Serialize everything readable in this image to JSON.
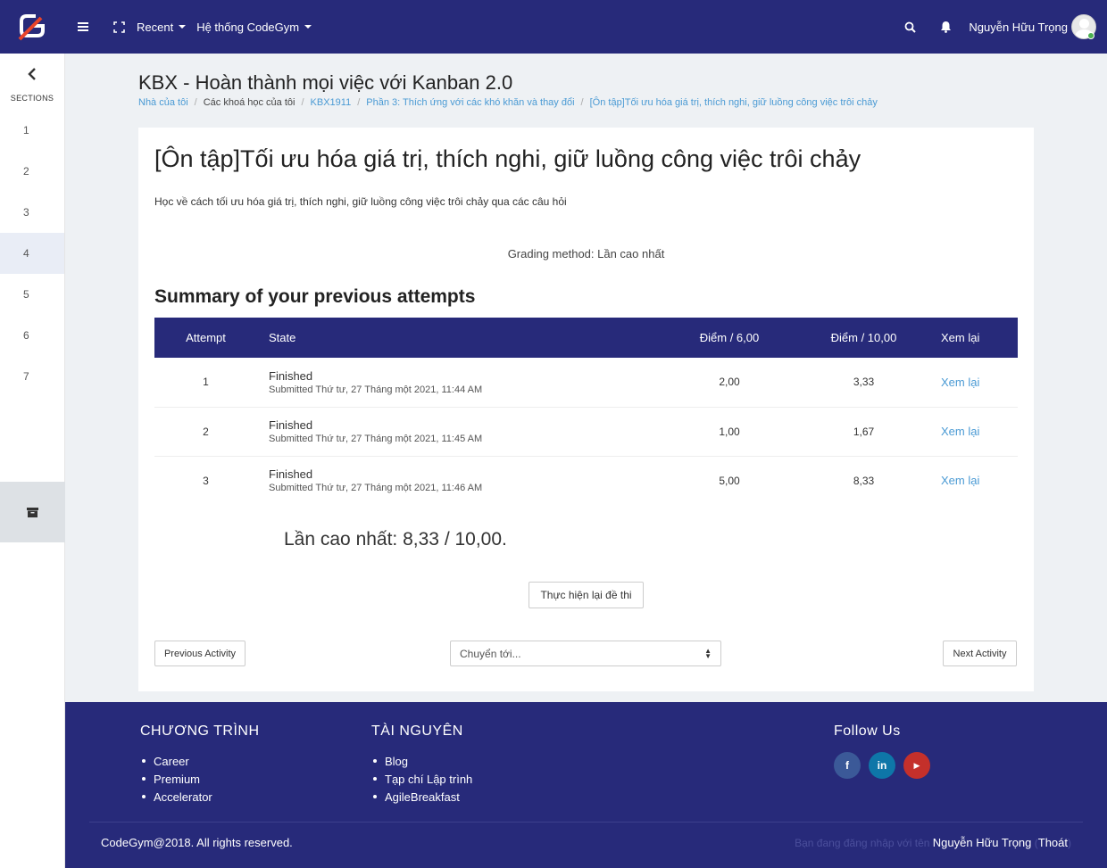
{
  "navbar": {
    "recent_label": "Recent",
    "system_label": "Hệ thống CodeGym",
    "username": "Nguyễn Hữu Trọng"
  },
  "sidebar": {
    "title": "SECTIONS",
    "items": [
      "1",
      "2",
      "3",
      "4",
      "5",
      "6",
      "7"
    ],
    "active_index": 3
  },
  "page": {
    "title": "KBX - Hoàn thành mọi việc với Kanban 2.0",
    "breadcrumb": [
      "Nhà của tôi",
      "Các khoá học của tôi",
      "KBX1911",
      "Phần 3: Thích ứng với các khó khăn và thay đổi",
      "[Ôn tập]Tối ưu hóa giá trị, thích nghi, giữ luồng công việc trôi chảy"
    ]
  },
  "quiz": {
    "title": "[Ôn tập]Tối ưu hóa giá trị, thích nghi, giữ luồng công việc trôi chảy",
    "description": "Học về cách tối ưu hóa giá trị, thích nghi, giữ luồng công việc trôi chảy qua các câu hỏi",
    "grading_method": "Grading method: Lần cao nhất",
    "summary_title": "Summary of your previous attempts",
    "columns": [
      "Attempt",
      "State",
      "Điểm / 6,00",
      "Điểm / 10,00",
      "Xem lại"
    ],
    "attempts": [
      {
        "attempt": "1",
        "state": "Finished",
        "submitted": "Submitted Thứ tư, 27 Tháng một 2021, 11:44 AM",
        "score6": "2,00",
        "score10": "3,33",
        "review": "Xem lại"
      },
      {
        "attempt": "2",
        "state": "Finished",
        "submitted": "Submitted Thứ tư, 27 Tháng một 2021, 11:45 AM",
        "score6": "1,00",
        "score10": "1,67",
        "review": "Xem lại"
      },
      {
        "attempt": "3",
        "state": "Finished",
        "submitted": "Submitted Thứ tư, 27 Tháng một 2021, 11:46 AM",
        "score6": "5,00",
        "score10": "8,33",
        "review": "Xem lại"
      }
    ],
    "highest_grade": "Lần cao nhất: 8,33 / 10,00.",
    "retry_label": "Thực hiện lại đề thi",
    "prev_label": "Previous Activity",
    "next_label": "Next Activity",
    "jump_placeholder": "Chuyển tới..."
  },
  "footer": {
    "col1": {
      "title": "CHƯƠNG TRÌNH",
      "items": [
        "Career",
        "Premium",
        "Accelerator"
      ]
    },
    "col2": {
      "title": "TÀI NGUYÊN",
      "items": [
        "Blog",
        "Tạp chí Lập trình",
        "AgileBreakfast"
      ]
    },
    "col3": {
      "title": "Follow Us",
      "social": [
        "facebook-icon",
        "linkedin-icon",
        "youtube-icon"
      ]
    },
    "copyright": "CodeGym@2018. All rights reserved.",
    "login_prefix": "Bạn đang đăng nhập với tên",
    "login_user": "Nguyễn Hữu Trọng",
    "logout_label": "Thoát"
  },
  "colors": {
    "primary": "#272a7a",
    "link": "#4a9ad4",
    "logo_red": "#e8442a"
  }
}
